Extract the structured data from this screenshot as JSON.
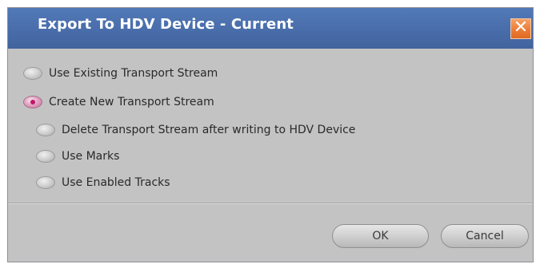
{
  "dialog": {
    "title": "Export To HDV Device - Current",
    "close_symbol": "✕"
  },
  "options": {
    "use_existing": "Use Existing Transport Stream",
    "create_new": "Create New Transport Stream",
    "delete_after": "Delete Transport Stream after writing to HDV Device",
    "use_marks": "Use Marks",
    "use_enabled_tracks": "Use Enabled Tracks"
  },
  "buttons": {
    "ok": "OK",
    "cancel": "Cancel"
  },
  "colors": {
    "titlebar": "#4a6eab",
    "close": "#ec7d36",
    "body": "#c4c3c4",
    "selected_radio": "#c0186a"
  }
}
